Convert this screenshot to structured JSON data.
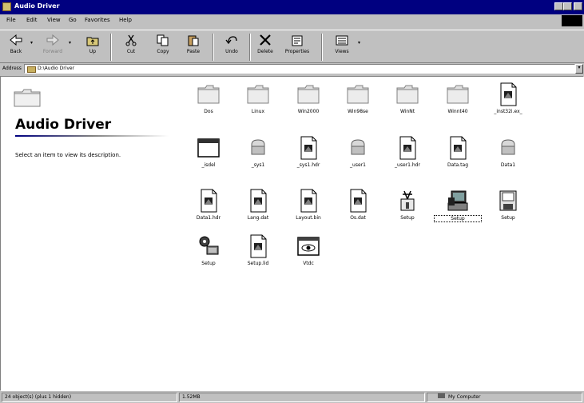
{
  "window": {
    "title": "Audio Driver"
  },
  "menu": [
    {
      "label": "File"
    },
    {
      "label": "Edit"
    },
    {
      "label": "View"
    },
    {
      "label": "Go"
    },
    {
      "label": "Favorites"
    },
    {
      "label": "Help"
    }
  ],
  "toolbar": {
    "back": "Back",
    "forward": "Forward",
    "up": "Up",
    "cut": "Cut",
    "copy": "Copy",
    "paste": "Paste",
    "undo": "Undo",
    "delete": "Delete",
    "properties": "Properties",
    "views": "Views"
  },
  "address": {
    "label": "Address",
    "value": "D:\\Audio Driver"
  },
  "left_pane": {
    "title": "Audio Driver",
    "description": "Select an item to view its description."
  },
  "files": [
    {
      "name": "Dos",
      "icon": "folder-icon"
    },
    {
      "name": "Linux",
      "icon": "folder-icon"
    },
    {
      "name": "Win2000",
      "icon": "folder-icon"
    },
    {
      "name": "Win98se",
      "icon": "folder-icon"
    },
    {
      "name": "WinNt",
      "icon": "folder-icon"
    },
    {
      "name": "Winnt40",
      "icon": "folder-icon"
    },
    {
      "name": "_inst32i.ex_",
      "icon": "document-icon"
    },
    {
      "name": "_isdel",
      "icon": "window-icon"
    },
    {
      "name": "_sys1",
      "icon": "cabinet-icon"
    },
    {
      "name": "_sys1.hdr",
      "icon": "document-icon"
    },
    {
      "name": "_user1",
      "icon": "cabinet-icon"
    },
    {
      "name": "_user1.hdr",
      "icon": "document-icon"
    },
    {
      "name": "Data.tag",
      "icon": "document-icon"
    },
    {
      "name": "Data1",
      "icon": "cabinet-icon"
    },
    {
      "name": "Data1.hdr",
      "icon": "document-icon"
    },
    {
      "name": "Lang.dat",
      "icon": "document-icon"
    },
    {
      "name": "Layout.bin",
      "icon": "document-icon"
    },
    {
      "name": "Os.dat",
      "icon": "document-icon"
    },
    {
      "name": "Setup",
      "icon": "setup-box-icon"
    },
    {
      "name": "Setup",
      "icon": "computer-setup-icon",
      "selected": true
    },
    {
      "name": "Setup",
      "icon": "disk-setup-icon"
    },
    {
      "name": "Setup",
      "icon": "gear-setup-icon"
    },
    {
      "name": "Setup.lid",
      "icon": "document-icon"
    },
    {
      "name": "Vtdc",
      "icon": "eye-window-icon"
    }
  ],
  "status": {
    "objects": "24 object(s) (plus 1 hidden)",
    "size": "1.52MB",
    "zone": "My Computer"
  },
  "colors": {
    "titlebar": "#000080",
    "face": "#c0c0c0",
    "content": "#ffffff"
  }
}
